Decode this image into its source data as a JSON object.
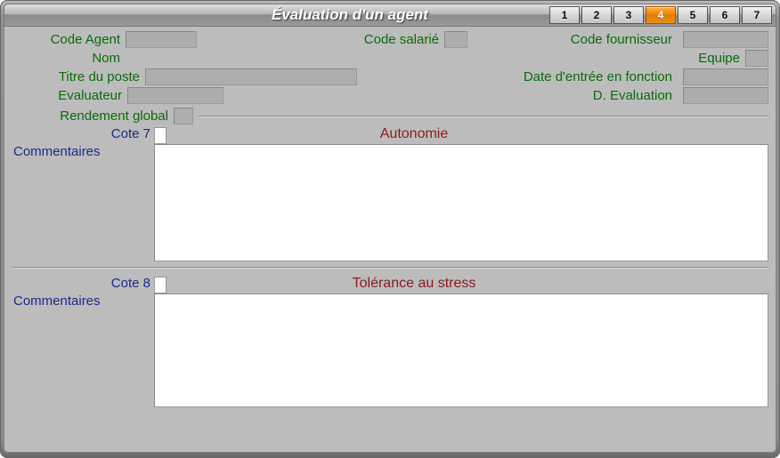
{
  "window": {
    "title": "Évaluation d'un agent"
  },
  "tabs": [
    {
      "label": "1",
      "active": false
    },
    {
      "label": "2",
      "active": false
    },
    {
      "label": "3",
      "active": false
    },
    {
      "label": "4",
      "active": true
    },
    {
      "label": "5",
      "active": false
    },
    {
      "label": "6",
      "active": false
    },
    {
      "label": "7",
      "active": false
    }
  ],
  "labels": {
    "code_agent": "Code Agent",
    "code_salarie": "Code salarié",
    "code_fournisseur": "Code fournisseur",
    "nom": "Nom",
    "equipe": "Equipe",
    "titre_poste": "Titre du poste",
    "date_entree": "Date d'entrée en fonction",
    "evaluateur": "Evaluateur",
    "d_evaluation": "D. Evaluation",
    "rendement_global": "Rendement global"
  },
  "fields": {
    "code_agent": "",
    "code_salarie": "",
    "code_fournisseur": "",
    "nom": "",
    "equipe": "",
    "titre_poste": "",
    "date_entree": "",
    "evaluateur": "",
    "d_evaluation": "",
    "rendement_global": ""
  },
  "sections": [
    {
      "cote_label": "Cote 7",
      "cote_value": "",
      "title": "Autonomie",
      "comments_label": "Commentaires",
      "comments_value": ""
    },
    {
      "cote_label": "Cote 8",
      "cote_value": "",
      "title": "Tolérance au stress",
      "comments_label": "Commentaires",
      "comments_value": ""
    }
  ]
}
